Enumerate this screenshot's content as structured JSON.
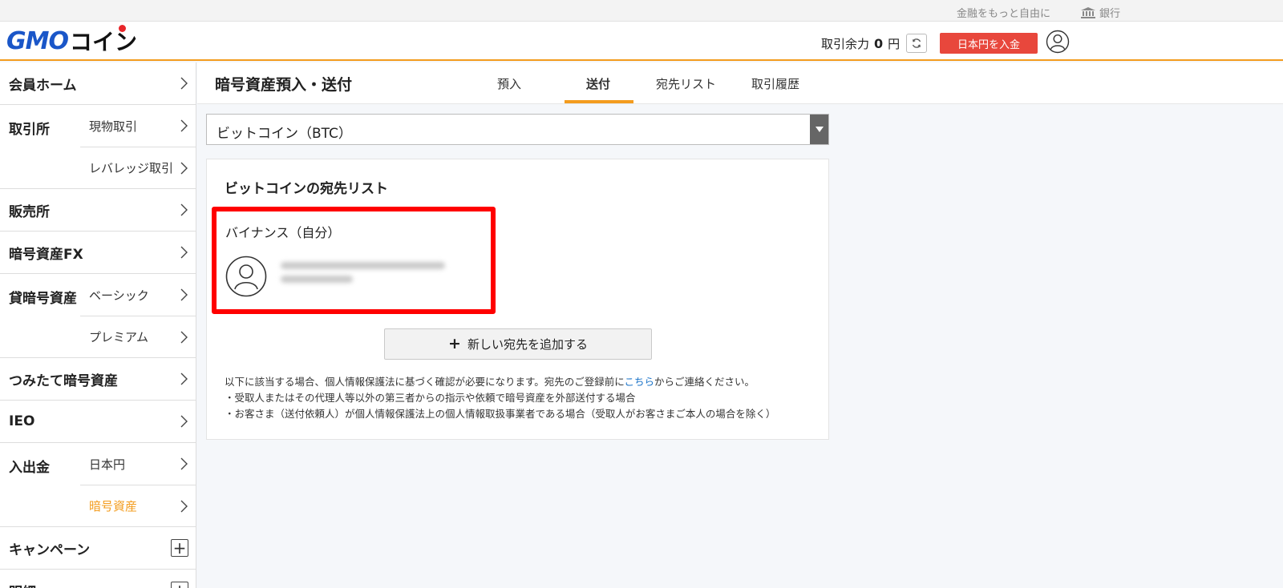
{
  "util": {
    "slogan": "金融をもっと自由に",
    "bank_label": "銀行"
  },
  "header": {
    "logo_gmo": "GMO",
    "logo_coin": "コイン",
    "margin_label": "取引余力",
    "margin_value": "0",
    "margin_unit": "円",
    "deposit_button": "日本円を入金"
  },
  "sidebar": {
    "home": "会員ホーム",
    "exchange": "取引所",
    "exchange_spot": "現物取引",
    "exchange_leverage": "レバレッジ取引",
    "shop": "販売所",
    "fx": "暗号資産FX",
    "lending": "貸暗号資産",
    "lending_basic": "ベーシック",
    "lending_premium": "プレミアム",
    "tsumitate": "つみたて暗号資産",
    "ieo": "IEO",
    "deposit": "入出金",
    "deposit_jpy": "日本円",
    "deposit_crypto": "暗号資産",
    "campaign": "キャンペーン",
    "statement": "明細"
  },
  "page": {
    "title": "暗号資産預入・送付",
    "tabs": [
      "預入",
      "送付",
      "宛先リスト",
      "取引履歴"
    ],
    "active_tab": "送付"
  },
  "select": {
    "value": "ビットコイン（BTC）"
  },
  "card": {
    "title": "ビットコインの宛先リスト",
    "address_name": "バイナンス（自分）",
    "add_button": "新しい宛先を追加する",
    "note_line1_a": "以下に該当する場合、個人情報保護法に基づく確認が必要になります。宛先のご登録前に",
    "note_link": "こちら",
    "note_line1_b": "からご連絡ください。",
    "note_line2": "・受取人またはその代理人等以外の第三者からの指示や依頼で暗号資産を外部送付する場合",
    "note_line3": "・お客さま（送付依頼人）が個人情報保護法上の個人情報取扱事業者である場合（受取人がお客さまご本人の場合を除く）"
  },
  "colors": {
    "accent_orange": "#f39c1e",
    "deposit_red": "#e8473c",
    "highlight_red": "#ff0000",
    "logo_blue": "#1a56c8",
    "link_blue": "#1a73c8"
  }
}
